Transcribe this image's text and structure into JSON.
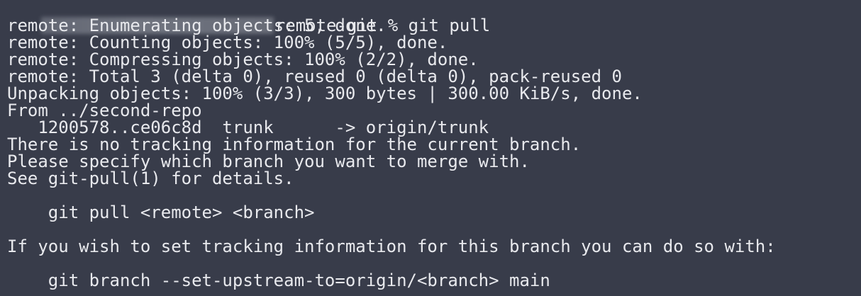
{
  "prompt": {
    "text": "remote-git % git pull"
  },
  "lines": [
    "remote: Enumerating objects: 5, done.",
    "remote: Counting objects: 100% (5/5), done.",
    "remote: Compressing objects: 100% (2/2), done.",
    "remote: Total 3 (delta 0), reused 0 (delta 0), pack-reused 0",
    "Unpacking objects: 100% (3/3), 300 bytes | 300.00 KiB/s, done.",
    "From ../second-repo",
    "   1200578..ce06c8d  trunk      -> origin/trunk",
    "There is no tracking information for the current branch.",
    "Please specify which branch you want to merge with.",
    "See git-pull(1) for details.",
    "",
    "    git pull <remote> <branch>",
    "",
    "If you wish to set tracking information for this branch you can do so with:",
    "",
    "    git branch --set-upstream-to=origin/<branch> main"
  ]
}
